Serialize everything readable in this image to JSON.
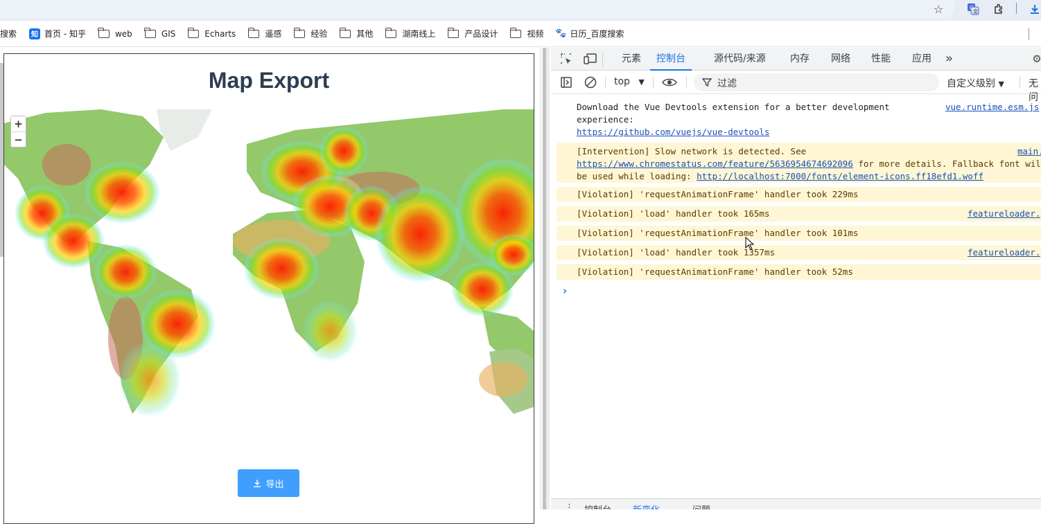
{
  "browser": {
    "icons": [
      "star-icon",
      "translate-icon",
      "extensions-icon",
      "download-icon"
    ]
  },
  "bookmarks": [
    {
      "label": "搜索",
      "icon": "none"
    },
    {
      "label": "首页 - 知乎",
      "icon": "zhihu-icon"
    },
    {
      "label": "web",
      "icon": "folder-icon"
    },
    {
      "label": "GIS",
      "icon": "folder-icon"
    },
    {
      "label": "Echarts",
      "icon": "folder-icon"
    },
    {
      "label": "遥感",
      "icon": "folder-icon"
    },
    {
      "label": "经验",
      "icon": "folder-icon"
    },
    {
      "label": "其他",
      "icon": "folder-icon"
    },
    {
      "label": "湖南线上",
      "icon": "folder-icon"
    },
    {
      "label": "产品设计",
      "icon": "folder-icon"
    },
    {
      "label": "视频",
      "icon": "folder-icon"
    },
    {
      "label": "日历_百度搜索",
      "icon": "baidu-paw-icon"
    }
  ],
  "app": {
    "title": "Map Export",
    "zoom_in": "+",
    "zoom_out": "−",
    "export_label": "导出",
    "export_icon": "download-icon",
    "accent_color": "#409eff"
  },
  "devtools": {
    "tabs": [
      "元素",
      "控制台",
      "源代码/来源",
      "内存",
      "网络",
      "性能",
      "应用"
    ],
    "active_tab": "控制台",
    "more_tabs": "»",
    "context": "top",
    "filter_placeholder": "过滤",
    "levels": "自定义级别",
    "no_issues": "无问",
    "messages": [
      {
        "type": "info",
        "lines": [
          "Download the Vue Devtools extension for a better development",
          "experience:"
        ],
        "link": "https://github.com/vuejs/vue-devtools",
        "source": "vue.runtime.esm.js"
      },
      {
        "type": "warn",
        "lines": [
          "[Intervention] Slow network is detected. See"
        ],
        "link": "https://www.chromestatus.com/feature/5636954674692096",
        "after_link": " for more details. Fallback font will",
        "line3_prefix": "be used while loading: ",
        "link2": "http://localhost:7000/fonts/element-icons.ff18efd1.woff",
        "source": "main.js"
      },
      {
        "type": "warn",
        "text": "[Violation] 'requestAnimationFrame' handler took 229ms",
        "source": ""
      },
      {
        "type": "warn",
        "text": "[Violation] 'load' handler took 165ms",
        "source": "featureloader.js"
      },
      {
        "type": "warn",
        "text": "[Violation] 'requestAnimationFrame' handler took 101ms",
        "source": ""
      },
      {
        "type": "warn",
        "text": "[Violation] 'load' handler took 1357ms",
        "source": "featureloader.js"
      },
      {
        "type": "warn",
        "text": "[Violation] 'requestAnimationFrame' handler took 52ms",
        "source": ""
      }
    ],
    "prompt": "›",
    "drawer_tabs": [
      "控制台",
      "新变化",
      "问题"
    ]
  }
}
